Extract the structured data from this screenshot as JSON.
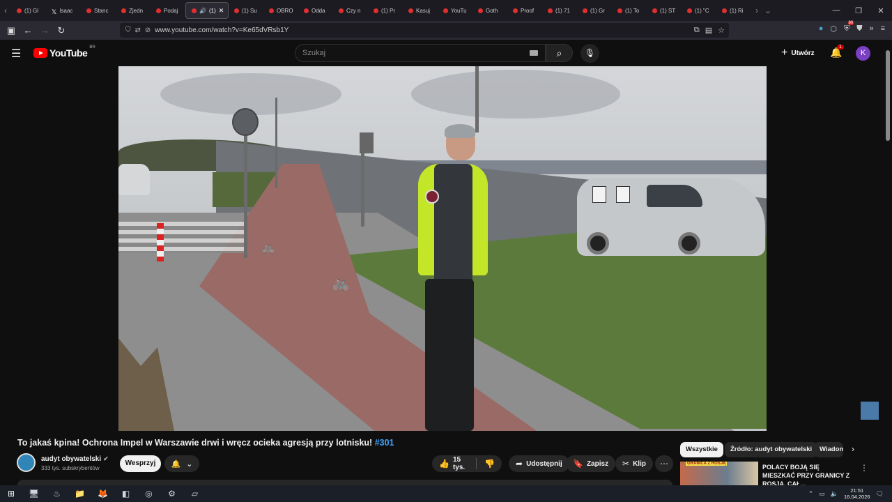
{
  "browser": {
    "tabs": [
      {
        "label": "(1) Gl",
        "icon": "youtube-favicon"
      },
      {
        "label": "Isaac",
        "icon": "x-favicon"
      },
      {
        "label": "Stanc",
        "icon": "youtube-favicon"
      },
      {
        "label": "Zjedn",
        "icon": "youtube-favicon"
      },
      {
        "label": "Podaj",
        "icon": "youtube-favicon"
      },
      {
        "label": "(1)",
        "icon": "youtube-favicon",
        "active": true
      },
      {
        "label": "(1) Su",
        "icon": "youtube-favicon"
      },
      {
        "label": "OBRO",
        "icon": "youtube-favicon"
      },
      {
        "label": "Odda",
        "icon": "youtube-favicon"
      },
      {
        "label": "Czy n",
        "icon": "youtube-favicon"
      },
      {
        "label": "(1) Pr",
        "icon": "youtube-favicon"
      },
      {
        "label": "Kasuj",
        "icon": "youtube-favicon"
      },
      {
        "label": "YouTu",
        "icon": "youtube-favicon"
      },
      {
        "label": "Goth",
        "icon": "youtube-favicon"
      },
      {
        "label": "Proof",
        "icon": "youtube-favicon"
      },
      {
        "label": "(1) 71",
        "icon": "youtube-favicon"
      },
      {
        "label": "(1) Gr",
        "icon": "youtube-favicon"
      },
      {
        "label": "(1) To",
        "icon": "youtube-favicon"
      },
      {
        "label": "(1) ST",
        "icon": "youtube-favicon"
      },
      {
        "label": "(1) \"C",
        "icon": "youtube-favicon"
      },
      {
        "label": "(1) Ri",
        "icon": "youtube-favicon"
      }
    ],
    "url": "www.youtube.com/watch?v=Ke65dVRsb1Y",
    "extension_badge": "80"
  },
  "youtube": {
    "logo_text": "YouTube",
    "logo_country": "BR",
    "search_placeholder": "Szukaj",
    "create_label": "Utwórz",
    "notification_count": "1",
    "avatar_letter": "K"
  },
  "video": {
    "title": "To jakaś kpina! Ochrona Impel w Warszawie drwi i wręcz ocieka agresją przy lotnisku!",
    "hashtag": "#301"
  },
  "channel": {
    "name": "audyt obywatelski",
    "subscribers": "333 tys. subskrybentów",
    "support_label": "Wesprzyj"
  },
  "actions": {
    "likes": "15 tys.",
    "share_label": "Udostępnij",
    "save_label": "Zapisz",
    "clip_label": "Klip"
  },
  "sidebar": {
    "chips": [
      "Wszystkie",
      "Źródło: audyt obywatelski",
      "Wiadom"
    ],
    "recommendation": {
      "title": "POLACY BOJĄ SIĘ MIESZKAĆ PRZY GRANICY Z ROSJĄ. CAŁ...",
      "thumb_label": "GRANICA Z ROSJĄ"
    }
  },
  "taskbar": {
    "time": "21:51",
    "date": "16.04.2026"
  },
  "colors": {
    "youtube_red": "#ff0000",
    "background": "#0f0f0f",
    "hashtag_blue": "#3ea6ff",
    "avatar_purple": "#7b3fc4"
  }
}
